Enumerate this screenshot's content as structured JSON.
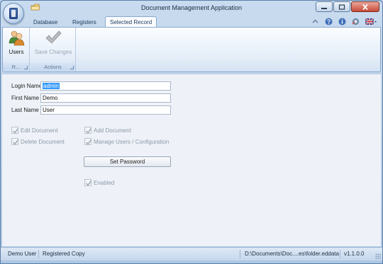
{
  "window": {
    "title": "Document Management Application"
  },
  "tabs": [
    {
      "label": "Database"
    },
    {
      "label": "Registers"
    },
    {
      "label": "Selected Record"
    }
  ],
  "ribbon": {
    "groups": [
      {
        "label": "R...",
        "buttons": [
          {
            "label": "Users",
            "icon": "users-icon",
            "enabled": true
          }
        ]
      },
      {
        "label": "Actions",
        "buttons": [
          {
            "label": "Save Changes",
            "icon": "checkmark-icon",
            "enabled": false
          }
        ]
      }
    ]
  },
  "form": {
    "login_label": "Login Name",
    "login_value": "admin",
    "first_name_label": "First Name",
    "first_name_value": "Demo",
    "last_name_label": "Last Name",
    "last_name_value": "User",
    "permissions": {
      "edit_document": "Edit Document",
      "add_document": "Add Document",
      "delete_document": "Delete Document",
      "manage_users": "Manage Users / Configuration"
    },
    "set_password_label": "Set Password",
    "enabled_label": "Enabled"
  },
  "statusbar": {
    "user": "Demo User",
    "license": "Registered Copy",
    "path": "D:\\Documents\\Doc....es\\folder.eddata",
    "version": "v1.1.0.0"
  }
}
